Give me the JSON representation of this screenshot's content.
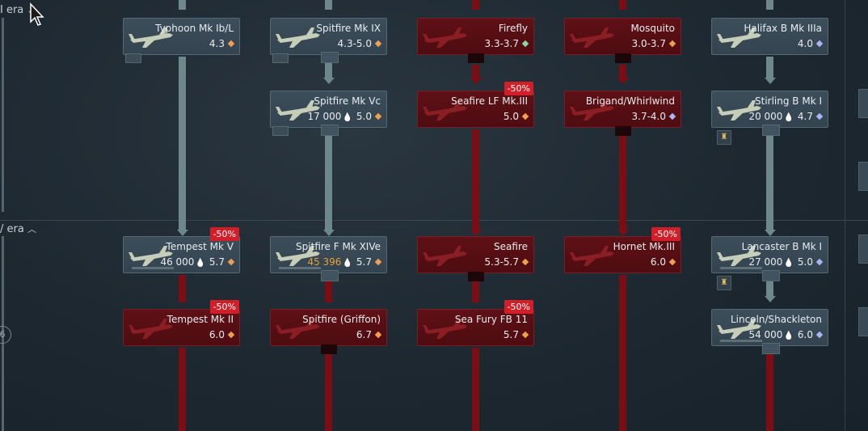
{
  "eras": [
    {
      "label": "I era",
      "chevron": "chevron-down-icon"
    },
    {
      "label": "/ era",
      "chevron": "chevron-up-icon"
    }
  ],
  "rank_label": "6",
  "colors": {
    "researched_card": "#3d4e5b",
    "locked_card": "#5e1116",
    "discount": "#d11f2a",
    "gem_ground": "#f0a050",
    "gem_naval": "#8ed6a0",
    "gem_bomber": "#a8b6f5",
    "rp_text": "#e8a23a"
  },
  "cards": [
    {
      "name": "Typhoon Mk Ib/L",
      "cost": "",
      "br": "4.3",
      "gem": "orange",
      "state": "researched",
      "discount": ""
    },
    {
      "name": "Spitfire Mk IX",
      "cost": "",
      "br": "4.3-5.0",
      "gem": "orange",
      "state": "researched",
      "discount": ""
    },
    {
      "name": "Firefly",
      "cost": "",
      "br": "3.3-3.7",
      "gem": "green",
      "state": "locked",
      "discount": ""
    },
    {
      "name": "Mosquito",
      "cost": "",
      "br": "3.0-3.7",
      "gem": "orange",
      "state": "locked",
      "discount": ""
    },
    {
      "name": "Halifax B Mk IIIa",
      "cost": "",
      "br": "4.0",
      "gem": "blue",
      "state": "researched",
      "discount": ""
    },
    {
      "name": "Spitfire Mk Vc",
      "cost": "17 000",
      "br": "5.0",
      "gem": "orange",
      "state": "researched",
      "discount": ""
    },
    {
      "name": "Seafire LF Mk.III",
      "cost": "",
      "br": "5.0",
      "gem": "orange",
      "state": "locked",
      "discount": "-50%"
    },
    {
      "name": "Brigand/Whirlwind",
      "cost": "",
      "br": "3.7-4.0",
      "gem": "blue",
      "state": "locked",
      "discount": ""
    },
    {
      "name": "Stirling B Mk I",
      "cost": "20 000",
      "br": "4.7",
      "gem": "blue",
      "state": "researched",
      "discount": ""
    },
    {
      "name": "Tempest Mk V",
      "cost": "46 000",
      "br": "5.7",
      "gem": "orange",
      "state": "researched",
      "discount": "-50%"
    },
    {
      "name": "Spitfire F Mk XIVe",
      "cost": "45 396",
      "br": "5.7",
      "gem": "orange",
      "state": "researched",
      "discount": "",
      "cost_orange": true
    },
    {
      "name": "Seafire",
      "cost": "",
      "br": "5.3-5.7",
      "gem": "orange",
      "state": "locked",
      "discount": ""
    },
    {
      "name": "Hornet Mk.III",
      "cost": "",
      "br": "6.0",
      "gem": "orange",
      "state": "locked",
      "discount": "-50%"
    },
    {
      "name": "Lancaster B Mk I",
      "cost": "27 000",
      "br": "5.0",
      "gem": "blue",
      "state": "researched",
      "discount": ""
    },
    {
      "name": "Tempest Mk II",
      "cost": "",
      "br": "6.0",
      "gem": "orange",
      "state": "locked",
      "discount": "-50%"
    },
    {
      "name": "Spitfire (Griffon)",
      "cost": "",
      "br": "6.7",
      "gem": "orange",
      "state": "locked",
      "discount": ""
    },
    {
      "name": "Sea Fury FB 11",
      "cost": "",
      "br": "5.7",
      "gem": "orange",
      "state": "locked",
      "discount": "-50%"
    },
    {
      "name": "Lincoln/Shackleton",
      "cost": "54 000",
      "br": "6.0",
      "gem": "blue",
      "state": "researched",
      "discount": ""
    }
  ]
}
